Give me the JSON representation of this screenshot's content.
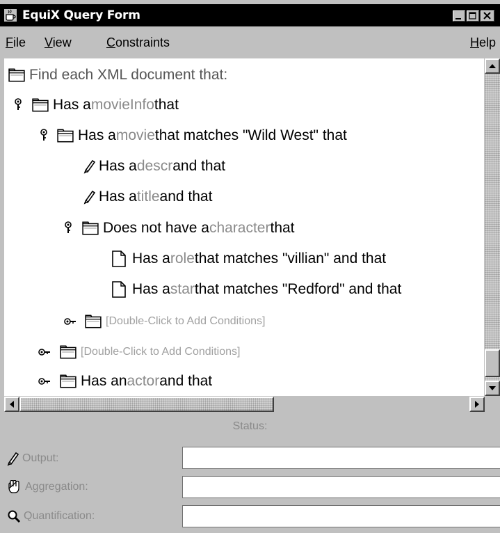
{
  "window": {
    "title": "EquiX Query Form",
    "icon": "java-cup-icon"
  },
  "menu": {
    "file": {
      "first": "F",
      "rest": "ile"
    },
    "view": {
      "first": "V",
      "rest": "iew"
    },
    "constraints": {
      "first": "C",
      "rest": "onstraints"
    },
    "help": {
      "first": "H",
      "rest": "elp"
    }
  },
  "tree": {
    "root": "Find each XML document that:",
    "n1": {
      "pre": "Has a ",
      "kw": "movieInfo",
      "post": " that"
    },
    "n2": {
      "pre": "Has a ",
      "kw": "movie",
      "post": " that matches \"Wild West\" that"
    },
    "n3": {
      "pre": "Has a ",
      "kw": "descr",
      "post": " and that"
    },
    "n4": {
      "pre": "Has a ",
      "kw": "title",
      "post": " and that"
    },
    "n5": {
      "pre": "Does not have a ",
      "kw": "character",
      "post": " that"
    },
    "n6": {
      "pre": "Has a ",
      "kw": "role",
      "post": " that matches \"villian\" and that"
    },
    "n7": {
      "pre": "Has a ",
      "kw": "star",
      "post": " that matches \"Redford\" and that"
    },
    "n8": "[Double-Click to Add Conditions]",
    "n9": "[Double-Click to Add Conditions]",
    "n10": {
      "pre": "Has an ",
      "kw": "actor",
      "post": " and that"
    }
  },
  "status": {
    "label": "Status:",
    "output_label": "Output:",
    "output_value": "",
    "aggregation_label": "Aggregation:",
    "aggregation_value": "",
    "quantification_label": "Quantification:",
    "quantification_value": ""
  },
  "colors": {
    "keyword": "#8a8a8a",
    "titlebar": "#000000",
    "panel": "#c0c0c0"
  }
}
